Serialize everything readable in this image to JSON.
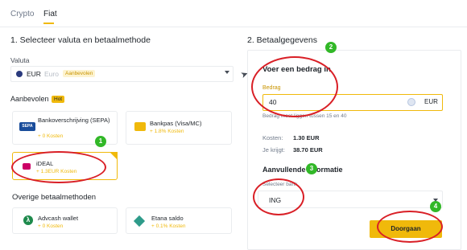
{
  "tabs": [
    {
      "label": "Crypto"
    },
    {
      "label": "Fiat"
    }
  ],
  "left": {
    "title": "1. Selecteer valuta en betaalmethode",
    "currency_label": "Valuta",
    "currency_code": "EUR",
    "currency_name": "Euro",
    "currency_badge": "Aanbevolen",
    "recommended_label": "Aanbevolen",
    "recommended_badge": "Hot",
    "methods": [
      {
        "title": "Bankoverschrijving (SEPA)",
        "fee": "+ 0 Kosten",
        "icon": "sepa-icon"
      },
      {
        "title": "Bankpas (Visa/MC)",
        "fee": "+ 1.8% Kosten",
        "icon": "card-icon"
      },
      {
        "title": "iDEAL",
        "fee": "+ 1.3EUR Kosten",
        "icon": "ideal-icon"
      }
    ],
    "other_label": "Overige betaalmethoden",
    "other_methods": [
      {
        "title": "Advcash wallet",
        "fee": "+ 0 Kosten",
        "icon": "advcash-icon"
      },
      {
        "title": "Etana saldo",
        "fee": "+ 0.1% Kosten",
        "icon": "etana-icon"
      }
    ]
  },
  "right": {
    "title": "2. Betaalgegevens",
    "amount_heading": "Voer een bedrag in",
    "amount_label": "Bedrag",
    "amount_value": "40",
    "amount_currency": "EUR",
    "amount_hint": "Bedrag moet liggen tussen 15 en 40",
    "fee_label": "Kosten:",
    "fee_value": "1.30 EUR",
    "receive_label": "Je krijgt:",
    "receive_value": "38.70 EUR",
    "extra_heading": "Aanvullende informatie",
    "bank_label": "Selecteer bank",
    "bank_value": "ING",
    "submit_label": "Doorgaan"
  },
  "annotations": [
    "1",
    "2",
    "3",
    "4"
  ],
  "colors": {
    "accent": "#f0b90b",
    "annotation_ring": "#d91f26",
    "annotation_badge": "#32b828"
  }
}
